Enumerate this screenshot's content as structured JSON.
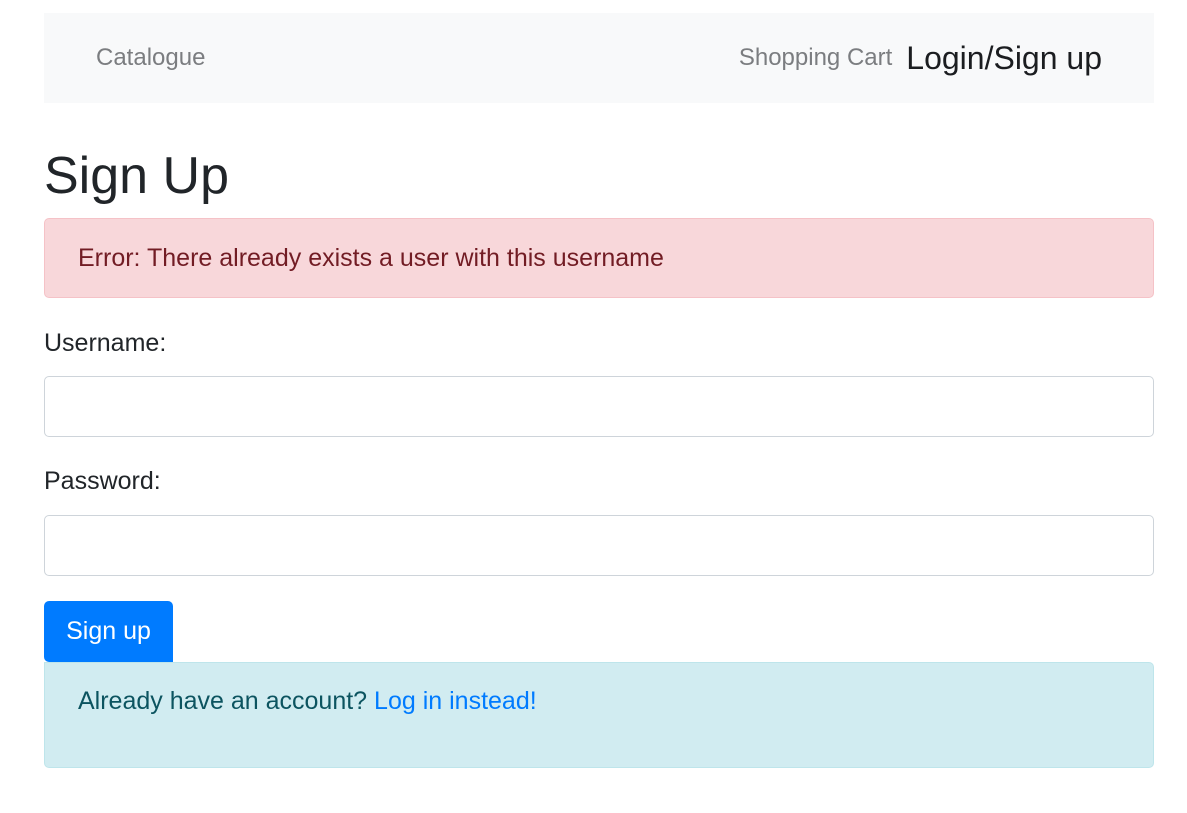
{
  "navbar": {
    "catalogue": "Catalogue",
    "shopping_cart": "Shopping Cart",
    "login_signup": "Login/Sign up"
  },
  "page": {
    "title": "Sign Up"
  },
  "error": {
    "message": "Error: There already exists a user with this username"
  },
  "form": {
    "username_label": "Username:",
    "username_value": "",
    "password_label": "Password:",
    "password_value": "",
    "submit_label": "Sign up"
  },
  "info": {
    "text": "Already have an account? ",
    "link": "Log in instead!"
  },
  "colors": {
    "primary": "#007bff",
    "error_bg": "#f8d7da",
    "error_text": "#721c24",
    "info_bg": "#d1ecf1",
    "info_text": "#0c5460",
    "navbar_bg": "#f8f9fa"
  }
}
